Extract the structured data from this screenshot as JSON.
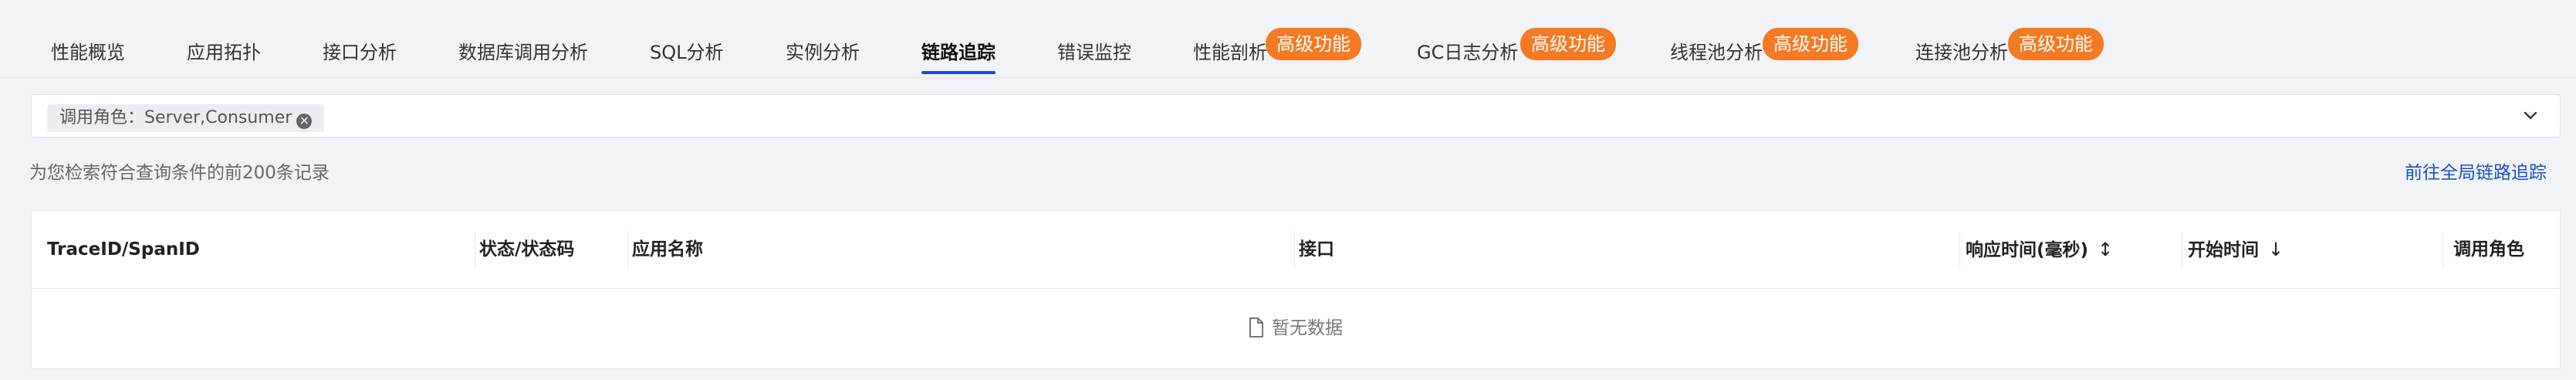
{
  "tabs": [
    {
      "label": "性能概览"
    },
    {
      "label": "应用拓扑"
    },
    {
      "label": "接口分析"
    },
    {
      "label": "数据库调用分析"
    },
    {
      "label": "SQL分析"
    },
    {
      "label": "实例分析"
    },
    {
      "label": "链路追踪",
      "active": true
    },
    {
      "label": "错误监控"
    },
    {
      "label": "性能剖析",
      "badge": "高级功能"
    },
    {
      "label": "GC日志分析",
      "badge": "高级功能"
    },
    {
      "label": "线程池分析",
      "badge": "高级功能"
    },
    {
      "label": "连接池分析",
      "badge": "高级功能"
    }
  ],
  "filter": {
    "chip_label": "调用角色：Server,Consumer"
  },
  "hint_text": "为您检索符合查询条件的前200条记录",
  "global_link": "前往全局链路追踪",
  "table": {
    "columns": [
      {
        "label": "TraceID/SpanID"
      },
      {
        "label": "状态/状态码"
      },
      {
        "label": "应用名称"
      },
      {
        "label": "接口"
      },
      {
        "label": "响应时间(毫秒)",
        "sort": "both"
      },
      {
        "label": "开始时间",
        "sort": "desc"
      },
      {
        "label": "调用角色"
      }
    ],
    "empty_text": "暂无数据"
  },
  "colors": {
    "accent": "#1e4bd8",
    "badge": "#f47a23",
    "link": "#1850c4"
  }
}
